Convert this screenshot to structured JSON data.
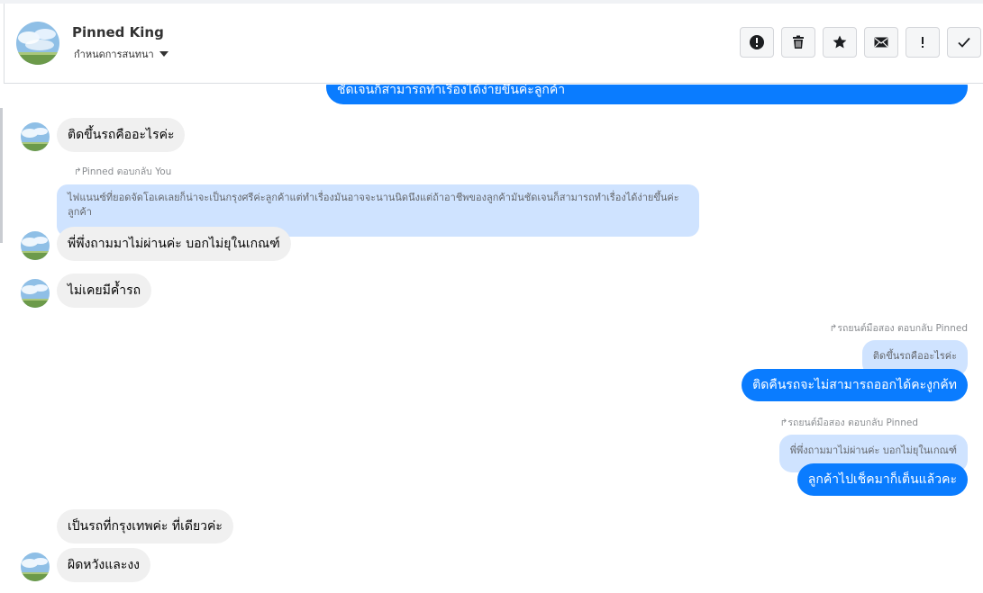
{
  "header": {
    "name": "Pinned King",
    "subtitle": "กำหนดการสนทนา",
    "tools": [
      {
        "name": "report-icon"
      },
      {
        "name": "trash-icon"
      },
      {
        "name": "star-icon"
      },
      {
        "name": "mail-icon"
      },
      {
        "name": "important-icon"
      },
      {
        "name": "check-icon"
      }
    ]
  },
  "messages": {
    "cut_top": "ชัดเจนก็สามารถทำเรื่องได้ง่ายขึ้นค่ะลูกค้า",
    "m1": "ติดขึ้นรถคืออะไรค่ะ",
    "r1_label": "Pinned ตอบกลับ You",
    "r1_quote": "ไฟแนนซ์ที่ยอดจัดโอเคเลยก็น่าจะเป็นกรุงศรีค่ะลูกค้าแต่ทำเรื่องมันอาจจะนานนิดนึงแต่ถ้าอาชีพของลูกค้ามันชัดเจนก็สามารถทำเรื่องได้ง่ายขึ้นค่ะลูกค้า",
    "m2": "พี่พึ่งถามมาไม่ผ่านค่ะ บอกไม่ยุในเกณฑ์",
    "m3": "ไม่เคยมีค้ำรถ",
    "r2_label": "รถยนต์มือสอง ตอบกลับ Pinned",
    "r2_quote": "ติดขึ้นรถคืออะไรค่ะ",
    "m4": "ติดคืนรถจะไม่สามารถออกได้คะงูกค้ท",
    "r3_label": "รถยนต์มือสอง ตอบกลับ Pinned",
    "r3_quote": "พี่พึ่งถามมาไม่ผ่านค่ะ บอกไม่ยุในเกณฑ์",
    "m5": "ลูกค้าไปเช็คมาก็เต็นแล้วคะ",
    "m6": "เป็นรถที่กรุงเทพค่ะ ที่เดียวค่ะ",
    "m7": "ผิดหวังและงง"
  },
  "colors": {
    "outgoing": "#0a7cff",
    "incoming": "#f0f0f0",
    "quote": "#cfe3ff"
  }
}
